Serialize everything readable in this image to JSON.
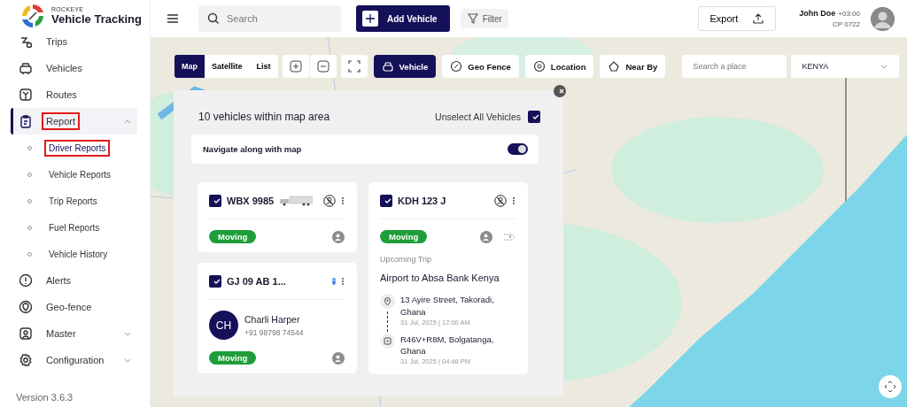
{
  "sidebar": {
    "logo": {
      "brand": "ROCKEYE",
      "title": "Vehicle Tracking"
    },
    "items": [
      {
        "label": "Trips",
        "kind": "link",
        "selected": false,
        "highlighted": false
      },
      {
        "label": "Vehicles",
        "kind": "link",
        "selected": false,
        "highlighted": false
      },
      {
        "label": "Routes",
        "kind": "link",
        "selected": false,
        "highlighted": false
      },
      {
        "label": "Report",
        "kind": "group",
        "selected": true,
        "expanded": true,
        "highlighted": true,
        "children": [
          {
            "label": "Driver Reports",
            "selected": true,
            "highlighted": true
          },
          {
            "label": "Vehicle Reports",
            "selected": false,
            "highlighted": false
          },
          {
            "label": "Trip Reports",
            "selected": false,
            "highlighted": false
          },
          {
            "label": "Fuel Reports",
            "selected": false,
            "highlighted": false
          },
          {
            "label": "Vehicle History",
            "selected": false,
            "highlighted": false
          }
        ]
      },
      {
        "label": "Alerts",
        "kind": "link",
        "selected": false,
        "highlighted": false
      },
      {
        "label": "Geo-fence",
        "kind": "link",
        "selected": false,
        "highlighted": false
      },
      {
        "label": "Master",
        "kind": "group",
        "selected": false,
        "expanded": false,
        "highlighted": false
      },
      {
        "label": "Configuration",
        "kind": "group",
        "selected": false,
        "expanded": false,
        "highlighted": false
      }
    ],
    "version": "Version 3.6.3"
  },
  "header": {
    "search": {
      "placeholder": "Search"
    },
    "add_button": "Add Vehicle",
    "filter_button": "Filter",
    "export_button": "Export",
    "user": {
      "name": "John Doe",
      "timezone": "+03:00",
      "code": "CP 0722"
    }
  },
  "map": {
    "view_tabs": [
      {
        "label": "Map",
        "selected": true
      },
      {
        "label": "Satellite",
        "selected": false
      },
      {
        "label": "List",
        "selected": false
      }
    ],
    "layers": [
      {
        "label": "Vehicle",
        "selected": true
      },
      {
        "label": "Geo Fence",
        "selected": false
      },
      {
        "label": "Location",
        "selected": false
      },
      {
        "label": "Near By",
        "selected": false
      }
    ],
    "place_search": {
      "placeholder": "Search a place"
    },
    "country": {
      "value": "KENYA"
    },
    "panel": {
      "title": "10 vehicles within map area",
      "unselect_all": {
        "label": "Unselect All Vehicles",
        "checked": true
      },
      "navigate": {
        "label": "Navigate along with map",
        "on": true
      },
      "columns": [
        {
          "cards": [
            {
              "plate": "WBX 9985",
              "kind": "truck",
              "checked": true,
              "status": "Moving"
            },
            {
              "plate": "GJ 09 AB 1...",
              "kind": "car",
              "checked": true,
              "status": "Moving",
              "driver": {
                "initials": "CH",
                "name": "Charli Harper",
                "phone": "+91 98798 74544"
              }
            }
          ]
        },
        {
          "cards": [
            {
              "plate": "KDH 123 J",
              "kind": "other",
              "checked": true,
              "status": "Moving",
              "trip": {
                "label": "Upcoming Trip",
                "title": "Airport to Absa Bank Kenya",
                "stops": [
                  {
                    "kind": "start",
                    "address": "13 Ayire Street, Takoradi, Ghana",
                    "time": "31 Jul, 2025 | 12:00 AM"
                  },
                  {
                    "kind": "end",
                    "address": "R46V+R8M, Bolgatanga, Ghana",
                    "time": "31 Jul, 2025 | 04:48 PM"
                  }
                ]
              }
            }
          ]
        }
      ]
    }
  }
}
